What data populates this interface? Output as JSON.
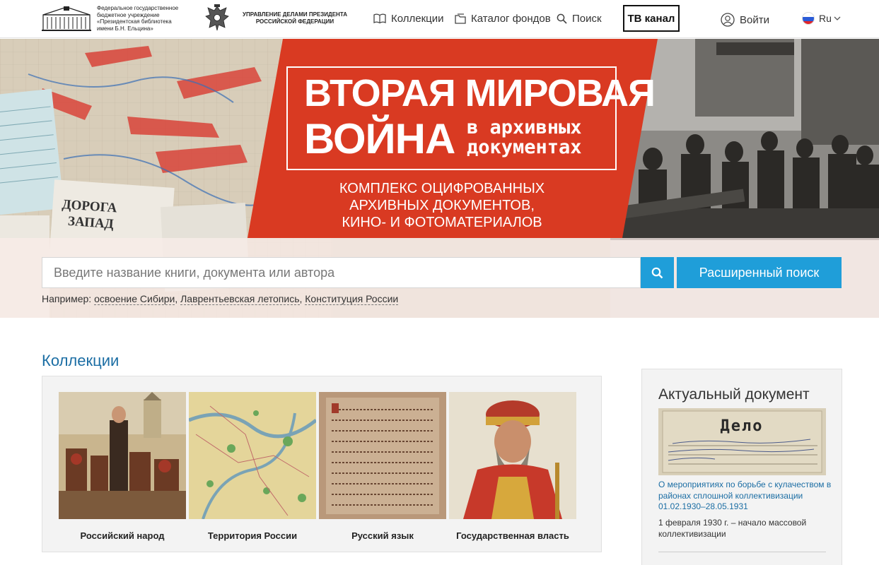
{
  "header": {
    "logo1_text": "Федеральное государственное бюджетное учреждение «Президентская библиотека имени Б.Н. Ельцина»",
    "logo2_text": "УПРАВЛЕНИЕ ДЕЛАМИ ПРЕЗИДЕНТА РОССИЙСКОЙ ФЕДЕРАЦИИ",
    "nav": {
      "collections": "Коллекции",
      "catalog": "Каталог фондов",
      "search": "Поиск",
      "tv": "ТВ канал",
      "login": "Войти",
      "lang": "Ru"
    }
  },
  "banner": {
    "title_line1": "ВТОРАЯ МИРОВАЯ",
    "title_line2": "ВОЙНА",
    "title_script_line1": "в архивных",
    "title_script_line2": "документах",
    "subtitle": "КОМПЛЕКС ОЦИФРОВАННЫХ АРХИВНЫХ ДОКУМЕНТОВ, КИНО- И ФОТОМАТЕРИАЛОВ",
    "map_text_1": "ДОРОГА",
    "map_text_2": "ЗАПАД"
  },
  "search": {
    "placeholder": "Введите название книги, документа или автора",
    "advanced_label": "Расширенный поиск",
    "examples_prefix": "Например:",
    "examples": [
      "освоение Сибири",
      "Лаврентьевская летопись",
      "Конституция России"
    ]
  },
  "collections": {
    "title": "Коллекции",
    "items": [
      {
        "label": "Российский народ"
      },
      {
        "label": "Территория России"
      },
      {
        "label": "Русский язык"
      },
      {
        "label": "Государственная власть"
      }
    ]
  },
  "sidebar": {
    "title": "Актуальный документ",
    "doc_image_text": "Дело",
    "doc_link": "О мероприятиях по борьбе с кулачеством в районах сплошной коллективизации 01.02.1930–28.05.1931",
    "doc_desc": "1 февраля 1930 г. – начало массовой коллективизации"
  },
  "colors": {
    "accent_blue": "#1f9ed9",
    "link_blue": "#1c6ea4",
    "banner_red": "#d93a22"
  }
}
